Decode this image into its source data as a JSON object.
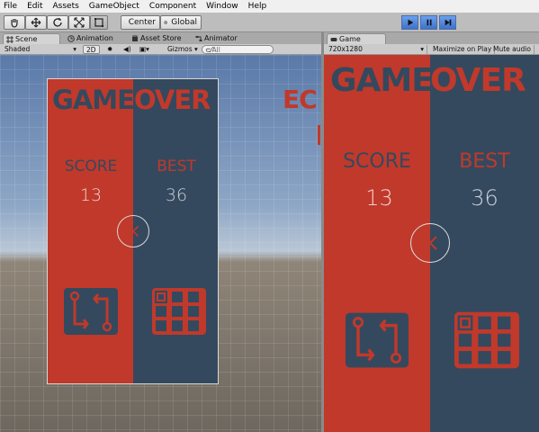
{
  "menu": [
    "File",
    "Edit",
    "Assets",
    "GameObject",
    "Component",
    "Window",
    "Help"
  ],
  "toolbar": {
    "tools": [
      "hand-tool",
      "move-tool",
      "rotate-tool",
      "scale-tool",
      "rect-tool"
    ],
    "pivot_label": "Center",
    "space_label": "Global"
  },
  "scene_tabs": [
    "Scene",
    "Animation",
    "Asset Store",
    "Animator"
  ],
  "game_tab": "Game",
  "scene_bar": {
    "shading": "Shaded",
    "mode2d": "2D",
    "gizmos": "Gizmos",
    "search_placeholder": "All"
  },
  "game_bar": {
    "resolution": "720x1280",
    "maximize": "Maximize on Play",
    "mute": "Mute audio"
  },
  "game_over": {
    "title_left": "GAME",
    "title_right": "OVER",
    "score_label": "SCORE",
    "best_label": "BEST",
    "score": "13",
    "best": "36"
  },
  "scene_offscreen_text": "EC",
  "colors": {
    "red": "#c0392b",
    "navy": "#34495e",
    "accent": "#4a7bd1"
  }
}
